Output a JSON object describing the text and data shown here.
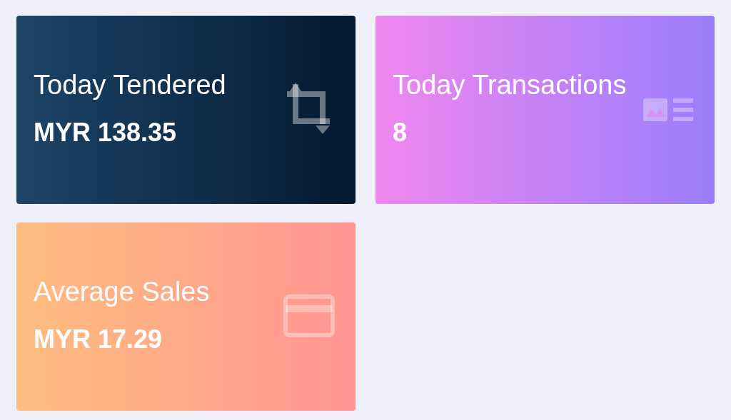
{
  "cards": [
    {
      "kind": "tendered",
      "title": "Today Tendered",
      "value": "MYR 138.35"
    },
    {
      "kind": "transactions",
      "title": "Today Transactions",
      "value": "8"
    },
    {
      "kind": "average",
      "title": "Average Sales",
      "value": "MYR 17.29"
    }
  ]
}
